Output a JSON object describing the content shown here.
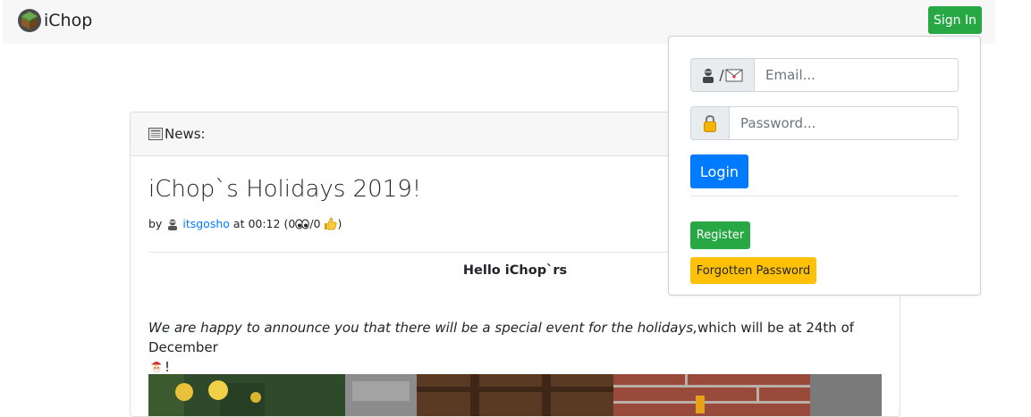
{
  "navbar": {
    "brand": "iChop",
    "brand_icon": "grass-block-icon",
    "signin_label": "Sign In"
  },
  "news": {
    "header_label": "News:",
    "header_icon": "newspaper-icon",
    "post": {
      "title": "iChop`s Holidays 2019!",
      "by_label": "by",
      "author": "itsgosho",
      "at_label": "at 00:12",
      "views_prefix": "(0",
      "likes_text": "/0",
      "meta_close": ")",
      "greeting": "Hello iChop`rs",
      "announcement_italic": "We are happy to announce you that there will be a special event for the holidays,",
      "announcement_rest": "which will be at 24th of December",
      "announcement_end": "!"
    }
  },
  "login": {
    "email_placeholder": "Email...",
    "password_placeholder": "Password...",
    "login_label": "Login",
    "register_label": "Register",
    "forgot_label": "Forgotten Password",
    "email_icon": "user-mail-icon",
    "password_icon": "lock-icon"
  },
  "colors": {
    "success": "#28a745",
    "primary": "#007bff",
    "warning": "#ffc107",
    "link": "#007bff"
  }
}
